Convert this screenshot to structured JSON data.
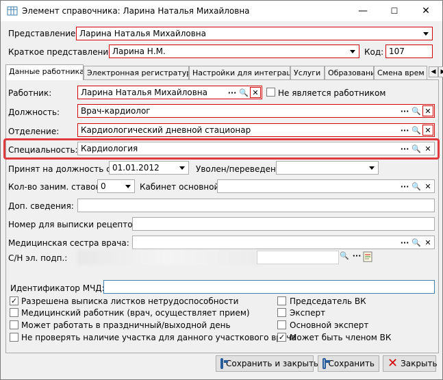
{
  "window": {
    "title": "Элемент справочника: Ларина Наталья Михайловна",
    "minimize": "—",
    "maximize": "☐",
    "close": "✕"
  },
  "header": {
    "presentation_label": "Представление:",
    "presentation_value": "Ларина Наталья Михайловна",
    "short_label": "Краткое представление:",
    "short_value": "Ларина Н.М.",
    "code_label": "Код:",
    "code_value": "107"
  },
  "tabs": [
    {
      "label": "Данные работника"
    },
    {
      "label": "Электронная регистратура"
    },
    {
      "label": "Настройки для интеграции"
    },
    {
      "label": "Услуги"
    },
    {
      "label": "Образование"
    },
    {
      "label": "Смена врем"
    }
  ],
  "form": {
    "worker_label": "Работник:",
    "worker_value": "Ларина Наталья Михайловна",
    "not_worker_label": "Не является работником",
    "position_label": "Должность:",
    "position_value": "Врач-кардиолог",
    "department_label": "Отделение:",
    "department_value": "Кардиологический дневной стационар",
    "specialty_label": "Специальность:",
    "specialty_value": "Кардиология",
    "hired_label": "Принят на должность с:",
    "hired_value": "01.01.2012",
    "fired_label": "Уволен/переведен",
    "fired_value": "",
    "rates_label": "Кол-во заним. ставок:",
    "rates_value": "0",
    "cabinet_label": "Кабинет основной:",
    "cabinet_value": "",
    "extra_label": "Доп. сведения:",
    "extra_value": "",
    "recipe_label": "Номер для выписки рецептов:",
    "recipe_value": "",
    "nurse_label": "Медицинская сестра врача:",
    "nurse_value": "",
    "cert_label": "С/Н эл. подп.:",
    "mchd_label": "Идентификатор МЧД:",
    "mchd_value": ""
  },
  "checkboxes_left": [
    {
      "label": "Разрешена выписка листков нетрудоспособности",
      "checked": true
    },
    {
      "label": "Медицинский работник (врач, осуществляет прием)",
      "checked": false
    },
    {
      "label": "Может работать в праздничный/выходной день",
      "checked": false
    },
    {
      "label": "Не проверять наличие участка для данного участкового врача",
      "checked": false
    }
  ],
  "checkboxes_right": [
    {
      "label": "Председатель ВК",
      "checked": false
    },
    {
      "label": "Эксперт",
      "checked": false
    },
    {
      "label": "Основной эксперт",
      "checked": false
    },
    {
      "label": "Может быть членом ВК",
      "checked": true
    }
  ],
  "buttons": {
    "save_close": "Сохранить и закрыть",
    "save": "Сохранить",
    "close": "Закрыть"
  },
  "glyphs": {
    "ellipsis": "···",
    "search": "🔍",
    "clear": "✕",
    "check": "✓"
  },
  "colors": {
    "required_border": "#d40000",
    "highlight_frame": "#e0393e"
  }
}
